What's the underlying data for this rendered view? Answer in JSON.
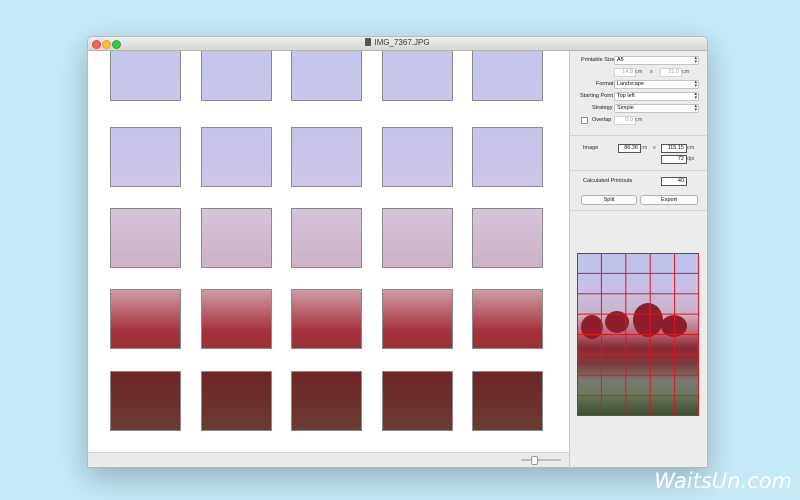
{
  "window": {
    "title": "IMG_7367.JPG"
  },
  "settings": {
    "printable_size_label": "Printable Size",
    "printable_size_value": "A5",
    "paper_width": "14.8",
    "paper_height": "21.0",
    "unit_cm": "cm",
    "times": "x",
    "format_label": "Format",
    "format_value": "Landscape",
    "starting_point_label": "Starting Point",
    "starting_point_value": "Top left",
    "strategy_label": "Strategy",
    "strategy_value": "Simple",
    "overlap_label": "Overlap",
    "overlap_value": "0.0"
  },
  "image": {
    "label": "Image",
    "width": "86.36",
    "height": "115.15",
    "dpi": "72",
    "dpi_unit": "dpi"
  },
  "printouts": {
    "label": "Calculated Printouts",
    "value": "40"
  },
  "actions": {
    "split": "Split",
    "export": "Export"
  },
  "preview": {
    "columns": 5,
    "rows": 8,
    "grid_color": "#e0161d"
  },
  "watermark": "WaitsUn.com",
  "colors": {
    "background": "#c5e9f7",
    "window": "#ececec"
  }
}
